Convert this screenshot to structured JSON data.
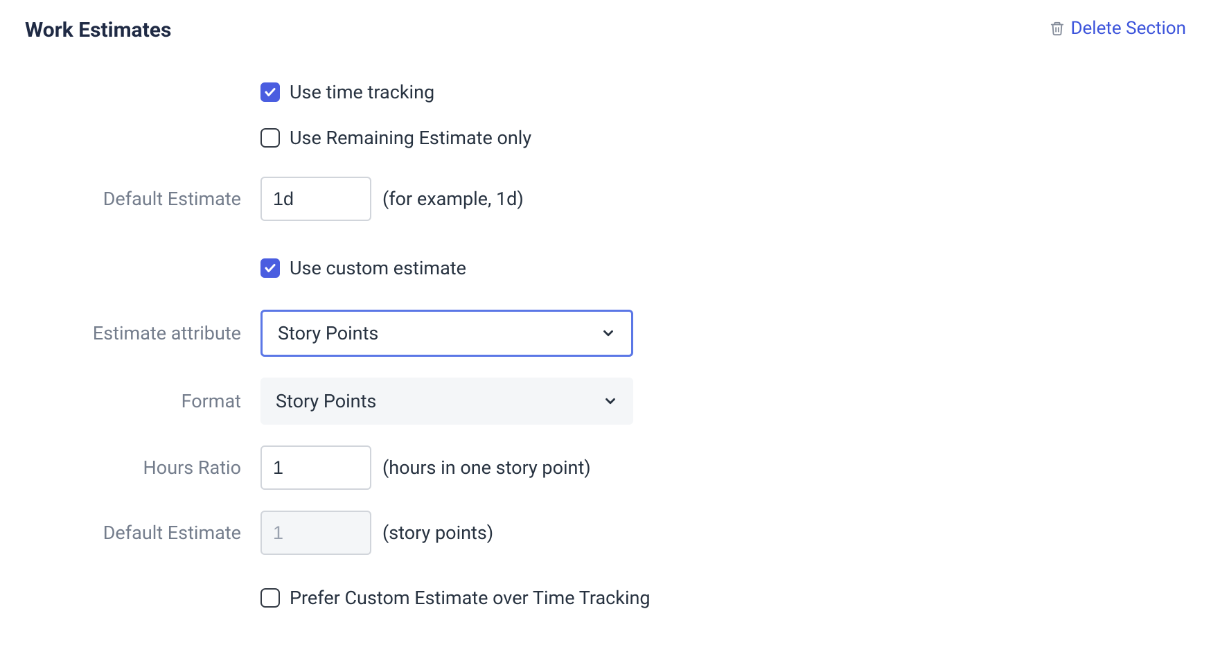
{
  "section": {
    "title": "Work Estimates",
    "delete_label": "Delete Section"
  },
  "form": {
    "use_time_tracking_label": "Use time tracking",
    "use_remaining_only_label": "Use Remaining Estimate only",
    "default_estimate_label": "Default Estimate",
    "default_estimate_value": "1d",
    "default_estimate_hint": "(for example, 1d)",
    "use_custom_estimate_label": "Use custom estimate",
    "estimate_attribute_label": "Estimate attribute",
    "estimate_attribute_value": "Story Points",
    "format_label": "Format",
    "format_value": "Story Points",
    "hours_ratio_label": "Hours Ratio",
    "hours_ratio_value": "1",
    "hours_ratio_hint": "(hours in one story point)",
    "default_estimate2_label": "Default Estimate",
    "default_estimate2_value": "1",
    "default_estimate2_hint": "(story points)",
    "prefer_custom_label": "Prefer Custom Estimate over Time Tracking"
  }
}
